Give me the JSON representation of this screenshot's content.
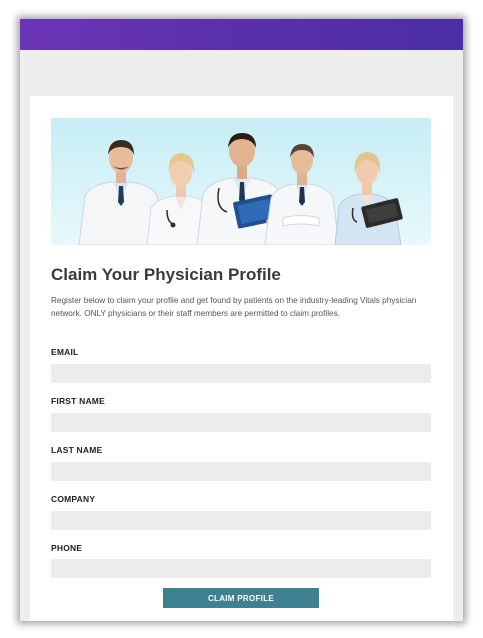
{
  "page": {
    "accent_color": "#5b2fae",
    "button_color": "#3f8190",
    "hero_image": "group-of-physicians-photo",
    "title": "Claim Your Physician Profile",
    "description": "Register below to claim your profile and get found by patients on the industry-leading Vitals physician network. ONLY physicians or their staff members are permitted to claim profiles."
  },
  "form": {
    "fields": [
      {
        "label": "EMAIL",
        "value": "",
        "placeholder": ""
      },
      {
        "label": "FIRST NAME",
        "value": "",
        "placeholder": ""
      },
      {
        "label": "LAST NAME",
        "value": "",
        "placeholder": ""
      },
      {
        "label": "COMPANY",
        "value": "",
        "placeholder": ""
      },
      {
        "label": "PHONE",
        "value": "",
        "placeholder": ""
      }
    ],
    "submit_label": "CLAIM PROFILE"
  }
}
